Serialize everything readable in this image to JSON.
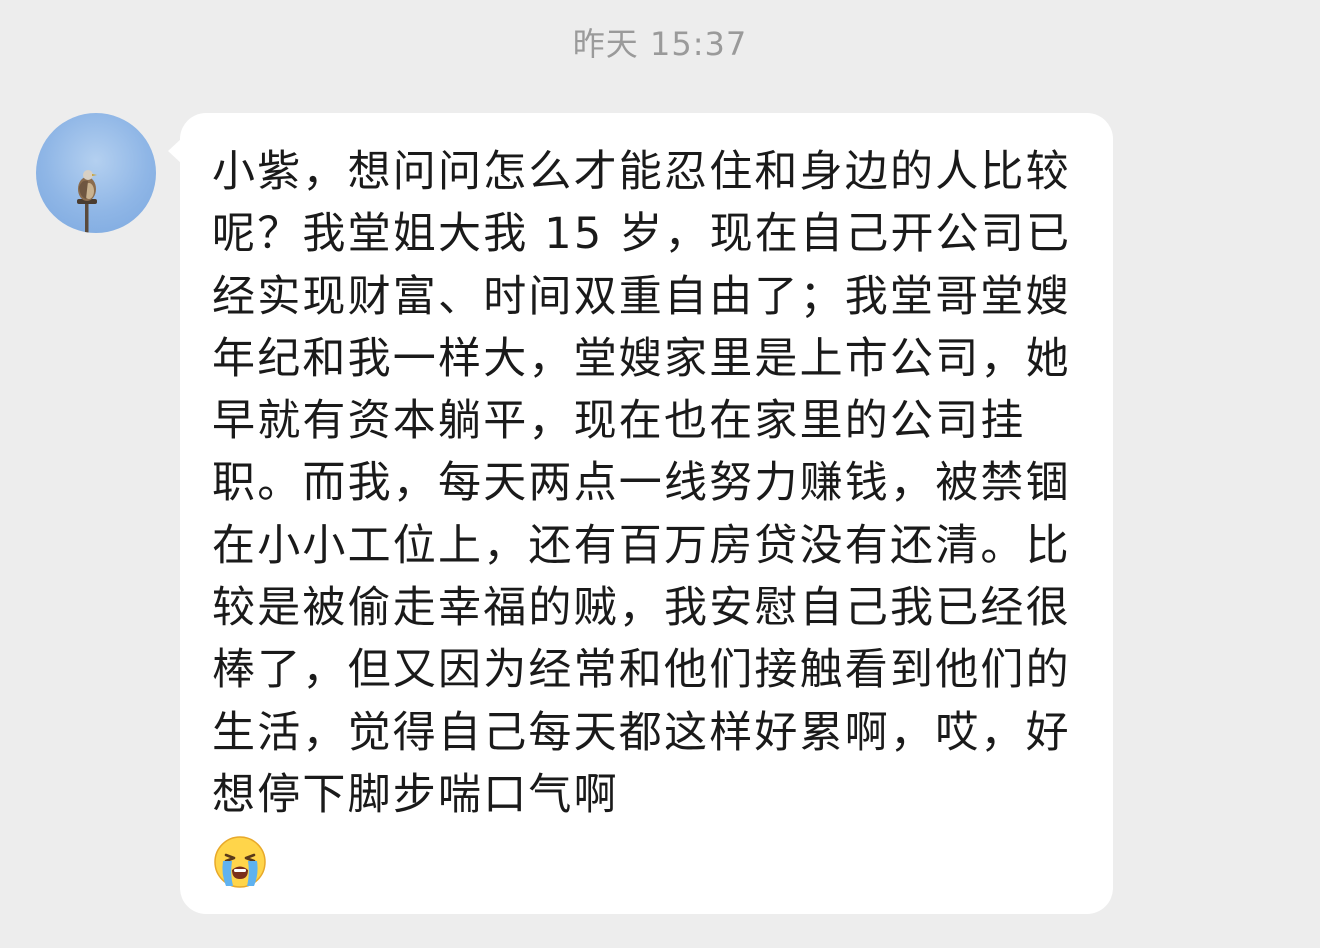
{
  "chat": {
    "timestamp": "昨天 15:37",
    "message": {
      "sender_avatar": "seagull-on-post-avatar",
      "text": "小紫，想问问怎么才能忍住和身边的人比较呢？我堂姐大我 15 岁，现在自己开公司已经实现财富、时间双重自由了；我堂哥堂嫂年纪和我一样大，堂嫂家里是上市公司，她早就有资本躺平，现在也在家里的公司挂职。而我，每天两点一线努力赚钱，被禁锢在小小工位上，还有百万房贷没有还清。比较是被偷走幸福的贼，我安慰自己我已经很棒了，但又因为经常和他们接触看到他们的生活，觉得自己每天都这样好累啊，哎，好想停下脚步喘口气啊",
      "trailing_emoji": "crying-face-emoji"
    }
  },
  "colors": {
    "background": "#ededed",
    "bubble": "#ffffff",
    "text": "#1a1a1a",
    "timestamp": "#9a9a9a"
  }
}
